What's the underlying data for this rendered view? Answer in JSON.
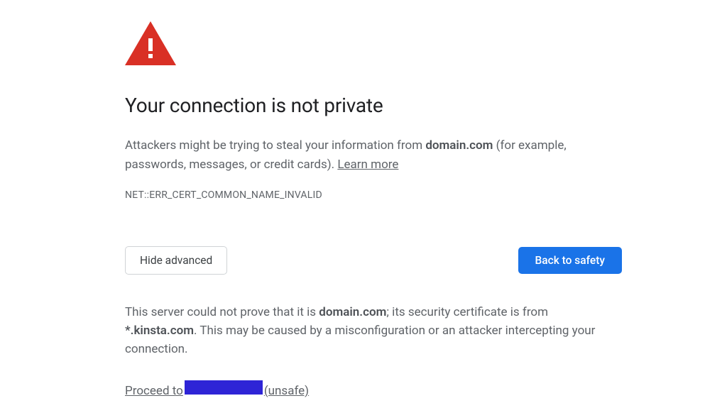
{
  "colors": {
    "danger": "#d93025",
    "primary": "#1a73e8"
  },
  "heading": "Your connection is not private",
  "warning": {
    "prefix": "Attackers might be trying to steal your information from ",
    "domain": "domain.com",
    "suffix": " (for example, passwords, messages, or credit cards). ",
    "learn_more": "Learn more"
  },
  "error_code": "NET::ERR_CERT_COMMON_NAME_INVALID",
  "buttons": {
    "hide_advanced": "Hide advanced",
    "back_to_safety": "Back to safety"
  },
  "advanced": {
    "part1": "This server could not prove that it is ",
    "domain": "domain.com",
    "part2": "; its security certificate is from ",
    "cert_from": "*.kinsta.com",
    "part3": ". This may be caused by a misconfiguration or an attacker intercepting your connection."
  },
  "proceed": {
    "prefix": "Proceed to ",
    "suffix": "(unsafe)"
  }
}
